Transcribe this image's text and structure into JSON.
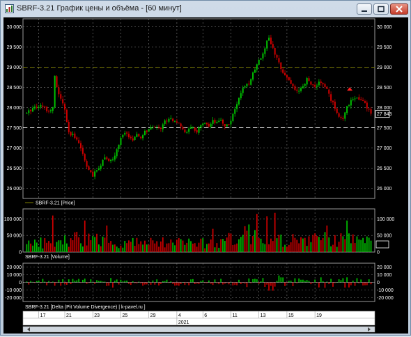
{
  "window": {
    "title": "SBRF-3.21 График цены и объёма - [60 минут]",
    "controls": {
      "minimize": "–",
      "maximize": "□",
      "close": "✕"
    }
  },
  "colors": {
    "background": "#000000",
    "up": "#00c000",
    "down": "#d00000",
    "grid": "#808080",
    "level_line": "#808000",
    "last_price_line": "#ffffff",
    "text": "#ffffff"
  },
  "chart_data": [
    {
      "type": "candlestick",
      "legend": "SBRF-3.21 [Price]",
      "y_ticks": [
        "30 000",
        "29 500",
        "29 000",
        "28 500",
        "28 000",
        "27 500",
        "27 000",
        "26 500",
        "26 000"
      ],
      "y_tick_values": [
        30000,
        29500,
        29000,
        28500,
        28000,
        27500,
        27000,
        26500,
        26000
      ],
      "ylim": [
        25750,
        30200
      ],
      "grid": true,
      "horizontal_levels": [
        {
          "value": 29000,
          "style": "dashed",
          "color": "#808000"
        },
        {
          "value": 27500,
          "style": "dashed",
          "color": "#ffffff"
        }
      ],
      "last_price_label": "27 843",
      "last_price": 27843,
      "close_path": [
        [
          0,
          27850
        ],
        [
          3,
          28000
        ],
        [
          6,
          28050
        ],
        [
          9,
          28000
        ],
        [
          11,
          27900
        ],
        [
          13,
          28050
        ],
        [
          14,
          28750
        ],
        [
          15,
          28500
        ],
        [
          17,
          28200
        ],
        [
          19,
          27950
        ],
        [
          21,
          27350
        ],
        [
          23,
          27300
        ],
        [
          25,
          27250
        ],
        [
          27,
          27000
        ],
        [
          29,
          26700
        ],
        [
          31,
          26450
        ],
        [
          33,
          26300
        ],
        [
          35,
          26450
        ],
        [
          37,
          26600
        ],
        [
          39,
          26800
        ],
        [
          41,
          26650
        ],
        [
          43,
          26700
        ],
        [
          45,
          26950
        ],
        [
          47,
          27250
        ],
        [
          49,
          27350
        ],
        [
          51,
          27300
        ],
        [
          53,
          27200
        ],
        [
          55,
          27300
        ],
        [
          57,
          27250
        ],
        [
          59,
          27400
        ],
        [
          61,
          27450
        ],
        [
          63,
          27500
        ],
        [
          65,
          27550
        ],
        [
          67,
          27500
        ],
        [
          69,
          27650
        ],
        [
          71,
          27750
        ],
        [
          73,
          27700
        ],
        [
          75,
          27650
        ],
        [
          77,
          27500
        ],
        [
          79,
          27400
        ],
        [
          81,
          27450
        ],
        [
          83,
          27500
        ],
        [
          85,
          27400
        ],
        [
          87,
          27550
        ],
        [
          89,
          27600
        ],
        [
          91,
          27500
        ],
        [
          93,
          27650
        ],
        [
          95,
          27600
        ],
        [
          97,
          27700
        ],
        [
          99,
          27550
        ],
        [
          101,
          27600
        ],
        [
          103,
          27800
        ],
        [
          105,
          28100
        ],
        [
          107,
          28400
        ],
        [
          109,
          28500
        ],
        [
          111,
          28600
        ],
        [
          113,
          28850
        ],
        [
          115,
          29100
        ],
        [
          117,
          29250
        ],
        [
          119,
          29500
        ],
        [
          121,
          29750
        ],
        [
          122,
          29600
        ],
        [
          124,
          29300
        ],
        [
          126,
          29100
        ],
        [
          128,
          28900
        ],
        [
          130,
          28750
        ],
        [
          132,
          28600
        ],
        [
          134,
          28450
        ],
        [
          136,
          28400
        ],
        [
          138,
          28500
        ],
        [
          140,
          28700
        ],
        [
          142,
          28600
        ],
        [
          144,
          28500
        ],
        [
          146,
          28650
        ],
        [
          148,
          28550
        ],
        [
          150,
          28450
        ],
        [
          152,
          28200
        ],
        [
          154,
          28000
        ],
        [
          156,
          27800
        ],
        [
          158,
          27700
        ],
        [
          160,
          28000
        ],
        [
          162,
          28200
        ],
        [
          164,
          28250
        ],
        [
          166,
          28200
        ],
        [
          168,
          28150
        ],
        [
          170,
          28000
        ],
        [
          172,
          27843
        ]
      ],
      "candle_count": 173
    },
    {
      "type": "bar",
      "legend": "SBRF-3.21 [Volume]",
      "y_ticks": [
        "100 000",
        "50 000",
        "0"
      ],
      "y_tick_values": [
        100000,
        50000,
        0
      ],
      "ylim": [
        0,
        130000
      ],
      "grid": true,
      "level_series": [
        [
          0,
          25000
        ],
        [
          10,
          30000
        ],
        [
          20,
          45000
        ],
        [
          30,
          40000
        ],
        [
          40,
          35000
        ],
        [
          50,
          30000
        ],
        [
          60,
          28000
        ],
        [
          70,
          30000
        ],
        [
          80,
          28000
        ],
        [
          90,
          32000
        ],
        [
          100,
          35000
        ],
        [
          110,
          60000
        ],
        [
          115,
          55000
        ],
        [
          120,
          45000
        ],
        [
          130,
          40000
        ],
        [
          140,
          35000
        ],
        [
          150,
          45000
        ],
        [
          160,
          38000
        ],
        [
          172,
          32000
        ]
      ],
      "peaks": [
        [
          13,
          110000
        ],
        [
          29,
          95000
        ],
        [
          40,
          80000
        ],
        [
          93,
          70000
        ],
        [
          115,
          115000
        ],
        [
          120,
          108000
        ],
        [
          124,
          118000
        ],
        [
          150,
          80000
        ],
        [
          160,
          95000
        ]
      ]
    },
    {
      "type": "bar",
      "legend": "SBRF-3.21 [Delta (Pit Volume Divergence) | k-pavel.ru ]",
      "y_ticks": [
        "20 000",
        "10 000",
        "0",
        "-10 000",
        "-20 000"
      ],
      "y_tick_values": [
        20000,
        10000,
        0,
        -10000,
        -20000
      ],
      "ylim": [
        -25000,
        25000
      ],
      "grid": true,
      "amplitude_series": [
        [
          0,
          4000
        ],
        [
          15,
          5000
        ],
        [
          30,
          6000
        ],
        [
          40,
          9000
        ],
        [
          50,
          4000
        ],
        [
          60,
          5000
        ],
        [
          70,
          4000
        ],
        [
          80,
          6000
        ],
        [
          90,
          4000
        ],
        [
          100,
          5000
        ],
        [
          110,
          7000
        ],
        [
          118,
          10000
        ],
        [
          124,
          12000
        ],
        [
          130,
          6000
        ],
        [
          140,
          5000
        ],
        [
          150,
          8000
        ],
        [
          160,
          7000
        ],
        [
          172,
          5000
        ]
      ]
    }
  ],
  "time_axis": {
    "day_labels": [
      "17",
      "21",
      "23",
      "25",
      "29",
      "4",
      "6",
      "11",
      "13",
      "15",
      "19"
    ],
    "day_positions": [
      6,
      19,
      33,
      47,
      61,
      75,
      88,
      102,
      116,
      130,
      144
    ],
    "year_label": "2021"
  }
}
